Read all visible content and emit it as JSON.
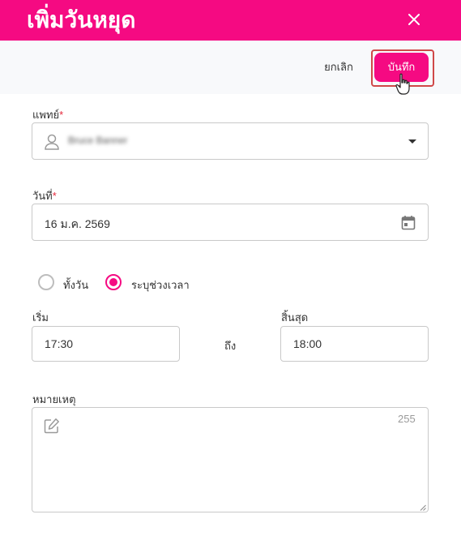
{
  "dialog": {
    "title": "เพิ่มวันหยุด",
    "close_icon": "close-icon"
  },
  "actions": {
    "cancel_label": "ยกเลิก",
    "save_label": "บันทึก"
  },
  "doctor": {
    "label": "แพทย์",
    "required_mark": "*",
    "value": "Bruce Banner",
    "icon": "person-icon"
  },
  "date": {
    "label": "วันที่",
    "required_mark": "*",
    "value": "16 ม.ค. 2569",
    "icon": "calendar-icon"
  },
  "duration": {
    "options": [
      {
        "label": "ทั้งวัน",
        "selected": false
      },
      {
        "label": "ระบุช่วงเวลา",
        "selected": true
      }
    ]
  },
  "time": {
    "start_label": "เริ่ม",
    "start_value": "17:30",
    "separator": "ถึง",
    "end_label": "สิ้นสุด",
    "end_value": "18:00"
  },
  "note": {
    "label": "หมายเหตุ",
    "counter": "255",
    "icon": "edit-icon"
  },
  "colors": {
    "accent": "#f50a82",
    "required": "#e5283b",
    "highlight_outline": "#d04848"
  }
}
